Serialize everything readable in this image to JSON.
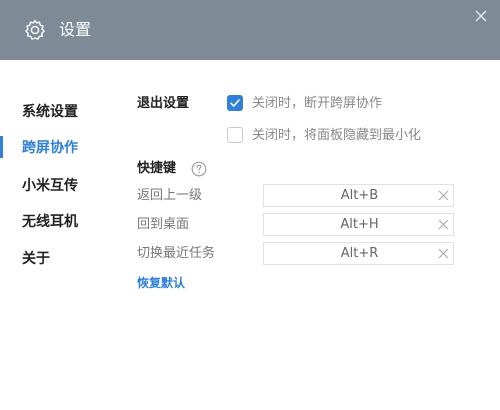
{
  "window": {
    "title": "设置",
    "icon": "gear-icon",
    "close_icon": "close-icon",
    "titlebar_color": "#7e8a96"
  },
  "sidebar": {
    "items": [
      {
        "label": "系统设置",
        "active": false
      },
      {
        "label": "跨屏协作",
        "active": true
      },
      {
        "label": "小米互传",
        "active": false
      },
      {
        "label": "无线耳机",
        "active": false
      },
      {
        "label": "关于",
        "active": false
      }
    ],
    "accent_color": "#2f80d6"
  },
  "exit_settings": {
    "label": "退出设置",
    "options": [
      {
        "label": "关闭时，断开跨屏协作",
        "checked": true
      },
      {
        "label": "关闭时，将面板隐藏到最小化",
        "checked": false
      }
    ]
  },
  "shortcuts": {
    "label": "快捷键",
    "help_icon": "question-circle-icon",
    "items": [
      {
        "label": "返回上一级",
        "value": "Alt+B"
      },
      {
        "label": "回到桌面",
        "value": "Alt+H"
      },
      {
        "label": "切换最近任务",
        "value": "Alt+R"
      }
    ],
    "restore_label": "恢复默认"
  }
}
